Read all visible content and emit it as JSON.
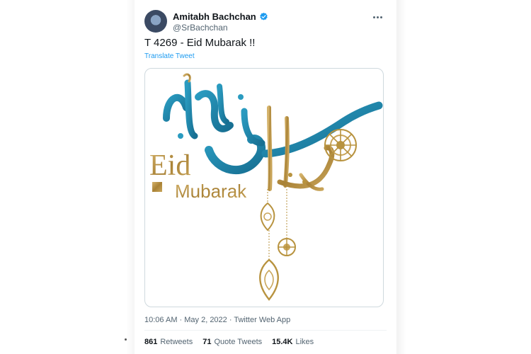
{
  "tweet": {
    "display_name": "Amitabh Bachchan",
    "handle": "@SrBachchan",
    "text": "T 4269 - Eid Mubarak !!",
    "translate_label": "Translate Tweet",
    "timestamp": "10:06 AM · May 2, 2022 · Twitter Web App"
  },
  "media": {
    "caption_eid": "Eid",
    "caption_mubarak": "Mubarak"
  },
  "stats": [
    {
      "count": "861",
      "label": "Retweets"
    },
    {
      "count": "71",
      "label": "Quote Tweets"
    },
    {
      "count": "15.4K",
      "label": "Likes"
    }
  ],
  "colors": {
    "verified": "#1d9bf0",
    "teal": "#1f86a8",
    "gold": "#b8933f"
  },
  "icons": {
    "verified": "verified-badge-icon",
    "more": "more-horizontal-icon"
  }
}
